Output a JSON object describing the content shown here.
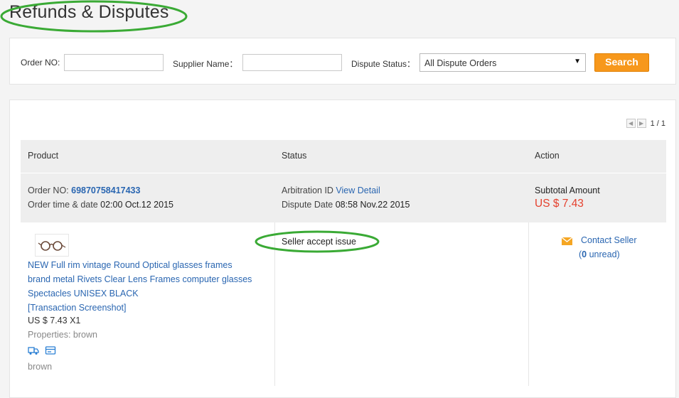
{
  "page": {
    "title": "Refunds & Disputes"
  },
  "search": {
    "order_no_label": "Order NO:",
    "order_no_value": "",
    "supplier_label": "Supplier Name：",
    "supplier_value": "",
    "status_label": "Dispute Status：",
    "status_selected": "All Dispute Orders",
    "button": "Search"
  },
  "pager": {
    "text": "1 / 1"
  },
  "table": {
    "columns": [
      "Product",
      "Status",
      "Action"
    ]
  },
  "order": {
    "order_no_label": "Order NO: ",
    "order_no": "69870758417433",
    "time_label": "Order time & date ",
    "time_value": "02:00 Oct.12 2015",
    "arbitration_label": "Arbitration ID ",
    "view_detail": "View Detail",
    "dispute_date_label": "Dispute Date ",
    "dispute_date": "08:58 Nov.22 2015",
    "subtotal_label": "Subtotal Amount",
    "subtotal": "US $ 7.43"
  },
  "product": {
    "title_lines": [
      "NEW Full rim vintage Round Optical glasses frames",
      "brand metal Rivets Clear Lens Frames computer glasses",
      "Spectacles UNISEX BLACK"
    ],
    "screenshot_link": "[Transaction Screenshot]",
    "price_qty": "US $ 7.43 X1",
    "properties": "Properties: brown",
    "variant": "brown",
    "icons": [
      "delivery-truck-icon",
      "card-icon"
    ]
  },
  "status": {
    "text": "Seller accept issue"
  },
  "action": {
    "contact_seller": "Contact Seller",
    "unread_prefix": "(",
    "unread_count": "0",
    "unread_suffix": " unread)",
    "mail_icon": "envelope-icon"
  },
  "colors": {
    "accent_button": "#f7981c",
    "link": "#2a66b1",
    "price": "#e5412e",
    "annotation": "#3aaa35"
  }
}
